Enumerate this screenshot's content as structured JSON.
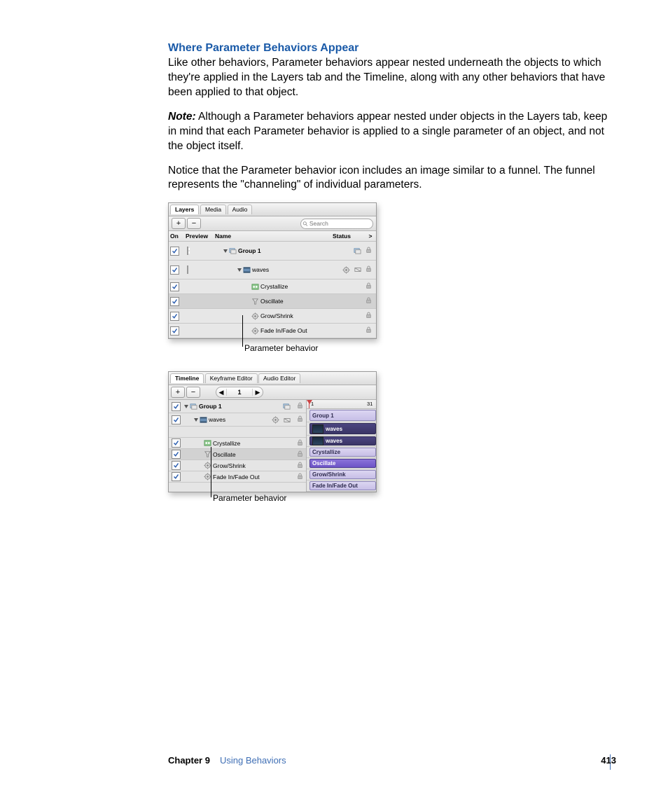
{
  "heading": "Where Parameter Behaviors Appear",
  "para1": "Like other behaviors, Parameter behaviors appear nested underneath the objects to which they're applied in the Layers tab and the Timeline, along with any other behaviors that have been applied to that object.",
  "note_label": "Note:",
  "note_body": "  Although a Parameter behaviors appear nested under objects in the Layers tab, keep in mind that each Parameter behavior is applied to a single parameter of an object, and not the object itself.",
  "para2": "Notice that the Parameter behavior icon includes an image similar to a funnel. The funnel represents the \"channeling\" of individual parameters.",
  "callout_text": "Parameter behavior",
  "panel1": {
    "tabs": [
      "Layers",
      "Media",
      "Audio"
    ],
    "search_placeholder": "Search",
    "columns": {
      "on": "On",
      "preview": "Preview",
      "name": "Name",
      "status": "Status",
      "arrow": ">"
    },
    "rows": [
      {
        "type": "group",
        "name": "Group 1",
        "indent": 0,
        "icons": [
          "stack",
          "lock"
        ]
      },
      {
        "type": "movie",
        "name": "waves",
        "indent": 1,
        "icons": [
          "gear",
          "clip",
          "lock"
        ]
      },
      {
        "type": "effect",
        "name": "Crystallize",
        "indent": 2,
        "icon": "filter",
        "icons": [
          "lock"
        ]
      },
      {
        "type": "behavior",
        "name": "Oscillate",
        "indent": 2,
        "icon": "funnel",
        "icons": [
          "lock"
        ],
        "selected": true
      },
      {
        "type": "behavior",
        "name": "Grow/Shrink",
        "indent": 2,
        "icon": "gear",
        "icons": [
          "lock"
        ]
      },
      {
        "type": "behavior",
        "name": "Fade In/Fade Out",
        "indent": 2,
        "icon": "gear",
        "icons": [
          "lock"
        ]
      }
    ]
  },
  "panel2": {
    "tabs": [
      "Timeline",
      "Keyframe Editor",
      "Audio Editor"
    ],
    "frame": "1",
    "ruler_ticks": [
      "1",
      "31"
    ],
    "rows": [
      {
        "type": "group",
        "name": "Group 1",
        "indent": 0,
        "clip": "Group 1",
        "clipType": "group",
        "icons": [
          "stack",
          "lock"
        ]
      },
      {
        "type": "movie",
        "name": "waves",
        "indent": 1,
        "clip": "waves",
        "clipType": "movie",
        "icons": [
          "gear",
          "clip",
          "lock"
        ]
      },
      {
        "type": "spacer",
        "clip": "waves",
        "clipType": "movie"
      },
      {
        "type": "effect",
        "name": "Crystallize",
        "indent": 2,
        "clip": "Crystallize",
        "clipType": "filter",
        "icons": [
          "lock"
        ]
      },
      {
        "type": "behavior",
        "name": "Oscillate",
        "indent": 2,
        "clip": "Oscillate",
        "clipType": "behavior",
        "selected": true,
        "icons": [
          "lock"
        ]
      },
      {
        "type": "behavior",
        "name": "Grow/Shrink",
        "indent": 2,
        "clip": "Grow/Shrink",
        "clipType": "behavior",
        "icons": [
          "lock"
        ]
      },
      {
        "type": "behavior",
        "name": "Fade In/Fade Out",
        "indent": 2,
        "clip": "Fade In/Fade Out",
        "clipType": "behavior",
        "icons": [
          "lock"
        ]
      }
    ]
  },
  "footer": {
    "chapter": "Chapter 9",
    "title": "Using Behaviors",
    "page": "413"
  }
}
